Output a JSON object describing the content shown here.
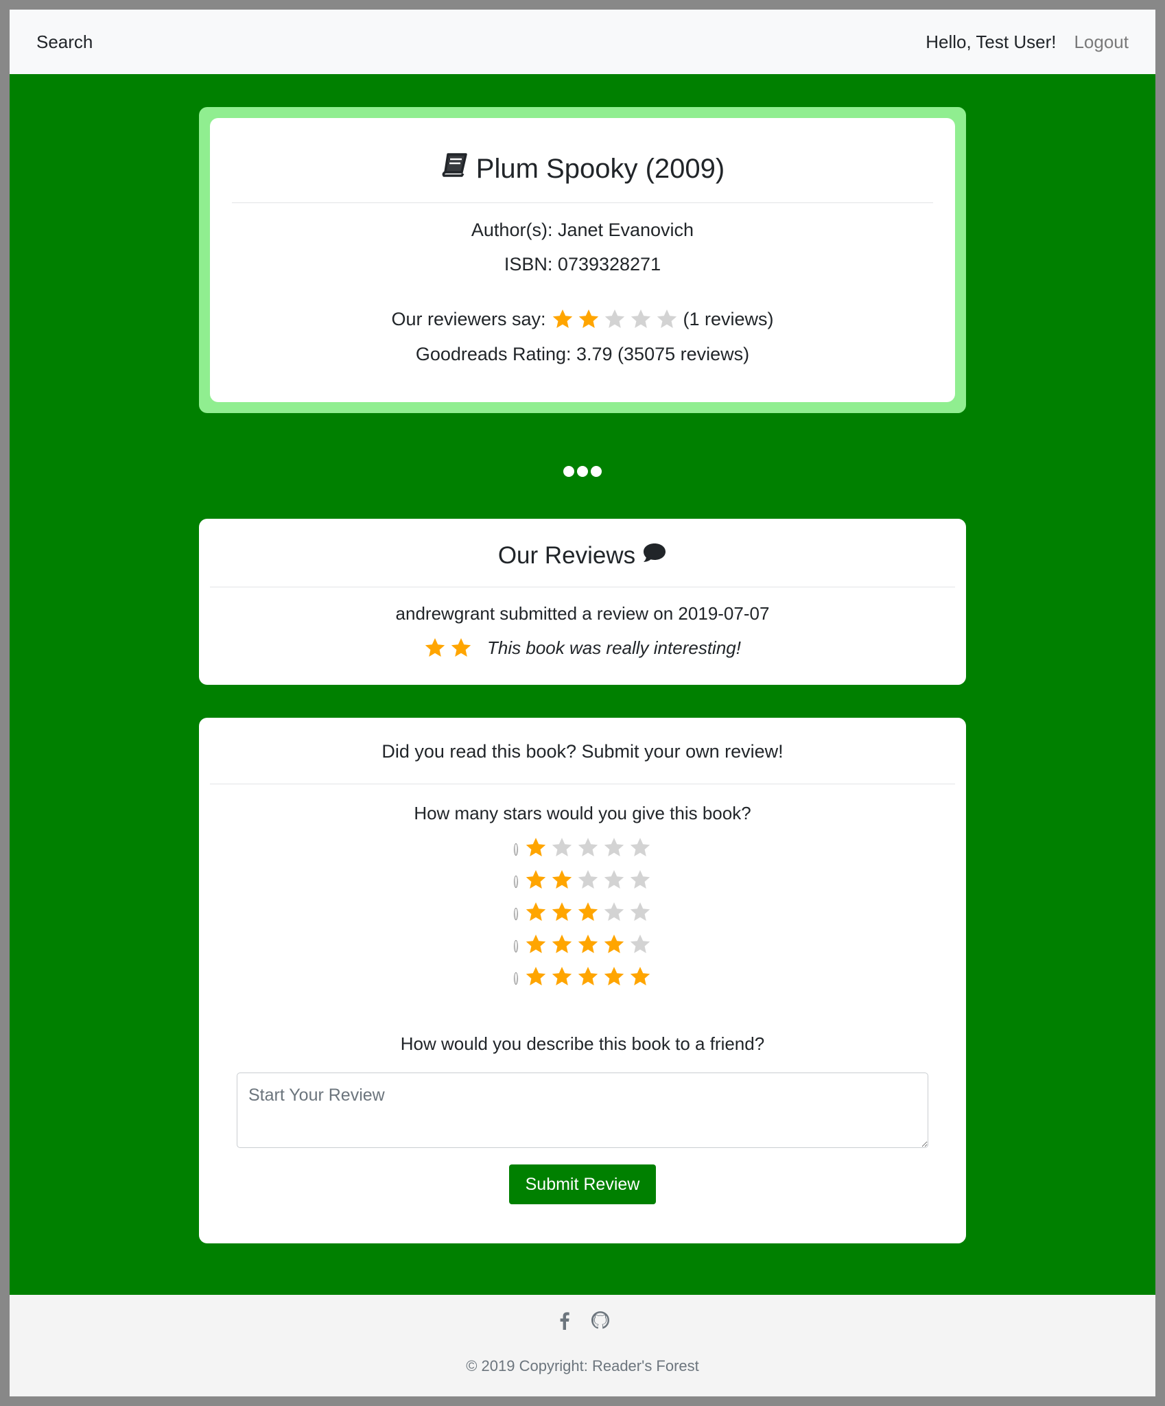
{
  "navbar": {
    "search_label": "Search",
    "greeting": "Hello, Test User!",
    "logout_label": "Logout"
  },
  "book": {
    "icon": "book-icon",
    "title": "Plum Spooky (2009)",
    "author_line": "Author(s): Janet Evanovich",
    "isbn_line": "ISBN: 0739328271",
    "our_reviewers_label": "Our reviewers say:",
    "our_rating_stars": 2,
    "our_rating_max": 5,
    "our_reviews_count": "(1 reviews)",
    "goodreads_line": "Goodreads Rating: 3.79 (35075 reviews)"
  },
  "reviews": {
    "title": "Our Reviews",
    "icon": "comment-icon",
    "items": [
      {
        "meta": "andrewgrant submitted a review on 2019-07-07",
        "stars": 2,
        "text": "This book was really interesting!"
      }
    ]
  },
  "submit": {
    "heading": "Did you read this book? Submit your own review!",
    "stars_question": "How many stars would you give this book?",
    "rating_options": [
      1,
      2,
      3,
      4,
      5
    ],
    "describe_question": "How would you describe this book to a friend?",
    "textarea_placeholder": "Start Your Review",
    "submit_label": "Submit Review"
  },
  "footer": {
    "icons": [
      "facebook-icon",
      "github-icon"
    ],
    "copyright": "© 2019 Copyright: Reader's Forest"
  },
  "colors": {
    "page_background": "#008000",
    "book_card_border": "#90ee90",
    "star_filled": "#ffa500",
    "star_empty": "#d3d3d3",
    "button": "#008000"
  }
}
